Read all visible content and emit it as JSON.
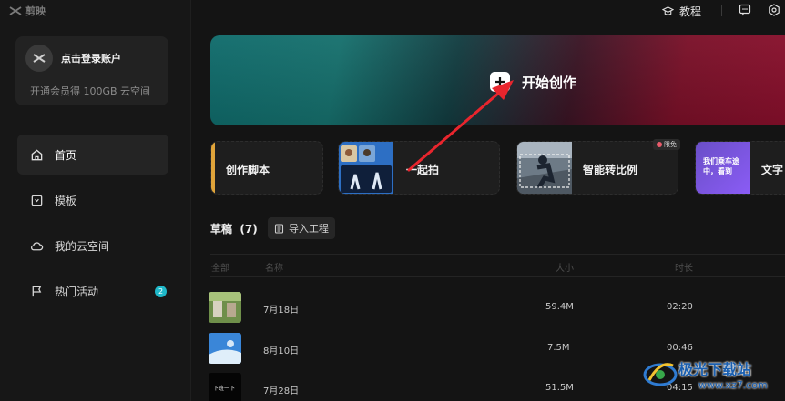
{
  "app": {
    "name": "剪映"
  },
  "topbar": {
    "tutorial_label": "教程"
  },
  "sidebar": {
    "login_label": "点击登录账户",
    "vip_promo": "开通会员得 100GB 云空间",
    "items": [
      {
        "label": "首页",
        "icon": "home-icon",
        "active": true
      },
      {
        "label": "模板",
        "icon": "template-icon"
      },
      {
        "label": "我的云空间",
        "icon": "cloud-icon"
      },
      {
        "label": "热门活动",
        "icon": "flag-icon",
        "badge": "2"
      }
    ]
  },
  "hero": {
    "label": "开始创作"
  },
  "quick_cards": [
    {
      "label": "创作脚本"
    },
    {
      "label": "一起拍"
    },
    {
      "label": "智能转比例",
      "badge": "限免"
    },
    {
      "label": "文字",
      "thumb_text": "我们乘车途中，看到"
    }
  ],
  "drafts": {
    "title": "草稿",
    "count": "(7)",
    "import_label": "导入工程",
    "columns": {
      "all": "全部",
      "name": "名称",
      "size": "大小",
      "duration": "时长"
    },
    "rows": [
      {
        "name": "7月18日",
        "size": "59.4M",
        "duration": "02:20"
      },
      {
        "name": "8月10日",
        "size": "7.5M",
        "duration": "00:46"
      },
      {
        "name": "7月28日",
        "size": "51.5M",
        "duration": "04:15",
        "thumb_text": "下班一下"
      }
    ]
  },
  "watermark": {
    "title": "极光下载站",
    "url": "www.xz7.com"
  },
  "colors": {
    "accent": "#1fb8c9",
    "script_bar": "#e0a43a",
    "annotation": "#e8252d",
    "watermark": "#1a5fb0"
  }
}
